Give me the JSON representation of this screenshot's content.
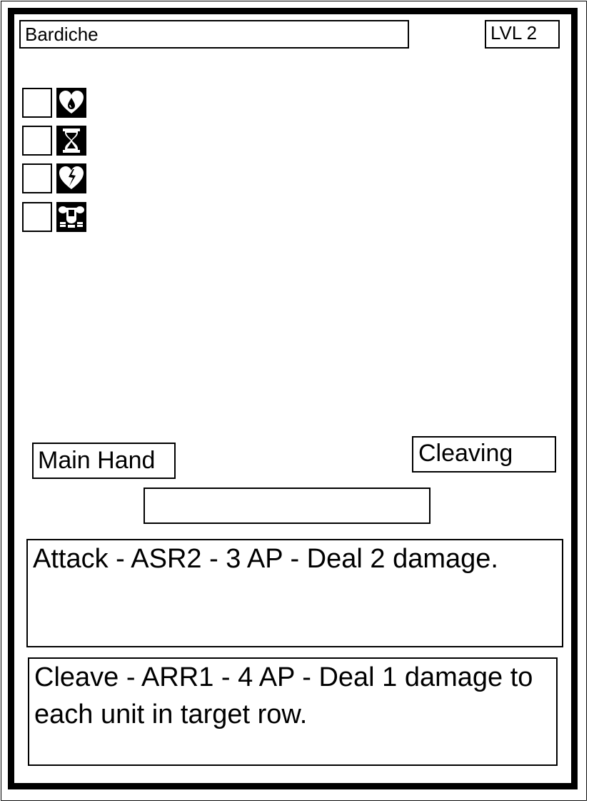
{
  "card": {
    "name": "Bardiche",
    "level": "LVL 2",
    "slot": "Main Hand",
    "type": "Cleaving",
    "blank_field": ""
  },
  "status_icons": [
    {
      "icon": "bleeding-heart-icon",
      "checked": false
    },
    {
      "icon": "hourglass-icon",
      "checked": false
    },
    {
      "icon": "broken-heart-icon",
      "checked": false
    },
    {
      "icon": "armor-icon",
      "checked": false
    }
  ],
  "abilities": [
    {
      "text": "Attack - ASR2 - 3 AP - Deal 2 damage."
    },
    {
      "text": "Cleave - ARR1 - 4 AP - Deal 1 damage to each unit in target row."
    }
  ],
  "colors": {
    "ink": "#000000",
    "paper": "#ffffff"
  }
}
